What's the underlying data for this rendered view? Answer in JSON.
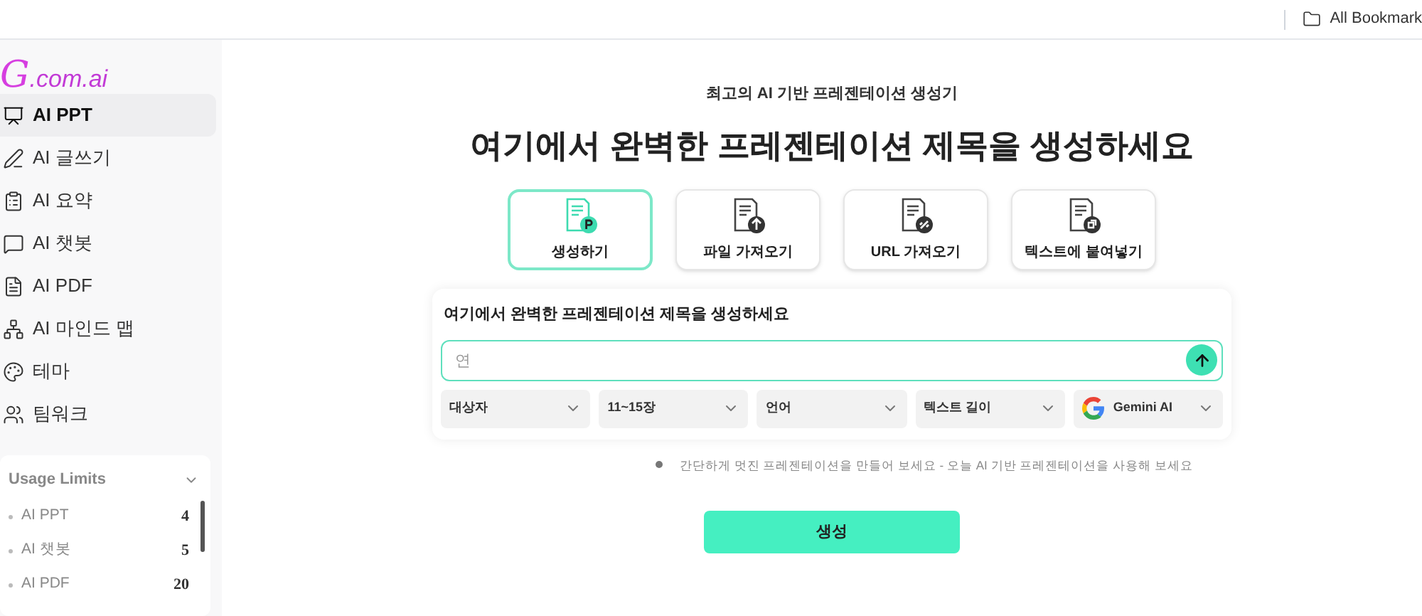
{
  "bookmark_bar": {
    "folder": "All Bookmark"
  },
  "logo": {
    "mark": "G",
    "suffix": ".com.ai"
  },
  "sidebar": {
    "items": [
      {
        "label": "AI PPT",
        "selected": true
      },
      {
        "label": "AI 글쓰기",
        "selected": false
      },
      {
        "label": "AI 요약",
        "selected": false
      },
      {
        "label": "AI 챗봇",
        "selected": false
      },
      {
        "label": "AI PDF",
        "selected": false
      },
      {
        "label": "AI 마인드 맵",
        "selected": false
      },
      {
        "label": "테마",
        "selected": false
      },
      {
        "label": "팀워크",
        "selected": false
      }
    ]
  },
  "usage_limits": {
    "title": "Usage Limits",
    "expanded": true,
    "items": [
      {
        "label": "AI PPT",
        "count": "4"
      },
      {
        "label": "AI 챗봇",
        "count": "5"
      },
      {
        "label": "AI PDF",
        "count": "20"
      }
    ]
  },
  "main": {
    "subtitle": "최고의 AI 기반 프레젠테이션 생성기",
    "title": "여기에서 완벽한 프레젠테이션 제목을 생성하세요",
    "modes": [
      {
        "label": "생성하기",
        "selected": true
      },
      {
        "label": "파일 가져오기",
        "selected": false
      },
      {
        "label": "URL 가져오기",
        "selected": false
      },
      {
        "label": "텍스트에 붙여넣기",
        "selected": false
      }
    ],
    "form": {
      "heading": "여기에서 완벽한 프레젠테이션 제목을 생성하세요",
      "input_value": "연",
      "selects": [
        {
          "label": "대상자",
          "kind": "plain"
        },
        {
          "label": "11~15장",
          "kind": "plain"
        },
        {
          "label": "언어",
          "kind": "plain"
        },
        {
          "label": "텍스트 길이",
          "kind": "plain"
        },
        {
          "label": "Gemini AI",
          "kind": "google"
        }
      ]
    },
    "tip": "간단하게 멋진 프레젠테이션을 만들어 보세요 - 오늘 AI 기반 프레젠테이션을 사용해 보세요",
    "submit": "생성"
  }
}
